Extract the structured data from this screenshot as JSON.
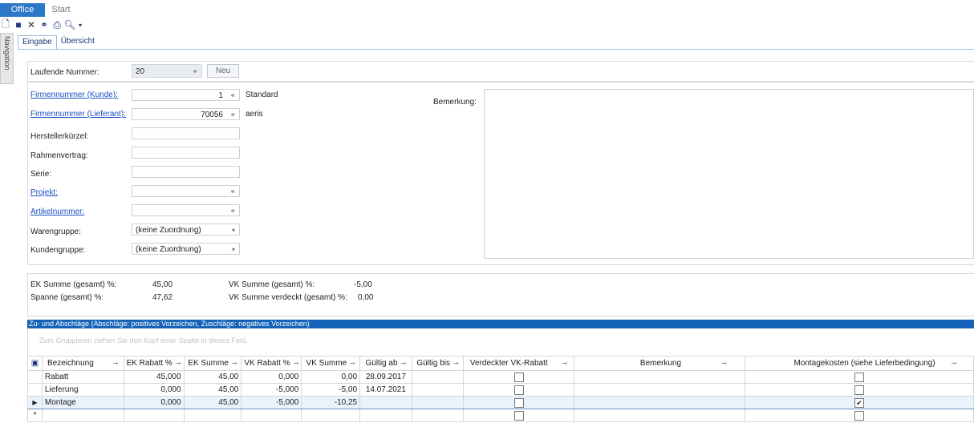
{
  "ribbon": {
    "tabs": [
      "Office",
      "Start"
    ]
  },
  "navigation": {
    "label": "Navigation"
  },
  "doc_tabs": [
    "Eingabe",
    "Übersicht"
  ],
  "header_panel": {
    "laufende_label": "Laufende Nummer:",
    "laufende_value": "20",
    "neu_button": "Neu"
  },
  "form": {
    "firma_kunde_label": "Firmennummer (Kunde):",
    "firma_kunde_value": "1",
    "firma_kunde_name": "Standard",
    "firma_lief_label": "Firmennummer (Lieferant):",
    "firma_lief_value": "70056",
    "firma_lief_name": "aeris",
    "hersteller_label": "Herstellerkürzel:",
    "rahmen_label": "Rahmenvertrag:",
    "serie_label": "Serie:",
    "projekt_label": "Projekt:",
    "artikel_label": "Artikelnummer:",
    "waren_label": "Warengruppe:",
    "waren_value": "(keine Zuordnung)",
    "kunden_label": "Kundengruppe:",
    "kunden_value": "(keine Zuordnung)",
    "bemerkung_label": "Bemerkung:"
  },
  "summary": {
    "ek_label": "EK Summe (gesamt) %:",
    "ek_value": "45,00",
    "spanne_label": "Spanne (gesamt) %:",
    "spanne_value": "47,62",
    "vk_label": "VK Summe (gesamt) %:",
    "vk_value": "-5,00",
    "vkv_label": "VK Summe verdeckt (gesamt) %:",
    "vkv_value": "0,00"
  },
  "grid": {
    "title": "Zu- und Abschläge (Abschläge: positives Vorzeichen, Zuschläge: negatives Vorzeichen)",
    "group_hint": "Zum Gruppieren ziehen Sie den Kopf einer Spalte in dieses Feld.",
    "columns": [
      "Bezeichnung",
      "EK Rabatt %",
      "EK Summe",
      "VK Rabatt %",
      "VK Summe",
      "Gültig ab",
      "Gültig bis",
      "Verdeckter VK-Rabatt",
      "Bemerkung",
      "Montagekosten (siehe Lieferbedingung)"
    ],
    "rows": [
      {
        "bez": "Rabatt",
        "ek_rabatt": "45,000",
        "ek_summe": "45,00",
        "vk_rabatt": "0,000",
        "vk_summe": "0,00",
        "ab": "28.09.2017",
        "bis": "",
        "verdeckt": false,
        "bem": "",
        "montage": false
      },
      {
        "bez": "Lieferung",
        "ek_rabatt": "0,000",
        "ek_summe": "45,00",
        "vk_rabatt": "-5,000",
        "vk_summe": "-5,00",
        "ab": "14.07.2021",
        "bis": "",
        "verdeckt": false,
        "bem": "",
        "montage": false
      },
      {
        "bez": "Montage",
        "ek_rabatt": "0,000",
        "ek_summe": "45,00",
        "vk_rabatt": "-5,000",
        "vk_summe": "-10,25",
        "ab": "",
        "bis": "",
        "verdeckt": false,
        "bem": "",
        "montage": true
      }
    ],
    "new_row_marker": "*",
    "current_row_marker": "▶"
  },
  "icons": [
    "new-icon",
    "save-icon",
    "delete-icon",
    "search-icon",
    "print-icon",
    "preview-icon",
    "qat-dropdown-icon",
    "binoculars-icon",
    "chevron-down-icon",
    "pin-icon",
    "checkbox-checked-icon"
  ]
}
